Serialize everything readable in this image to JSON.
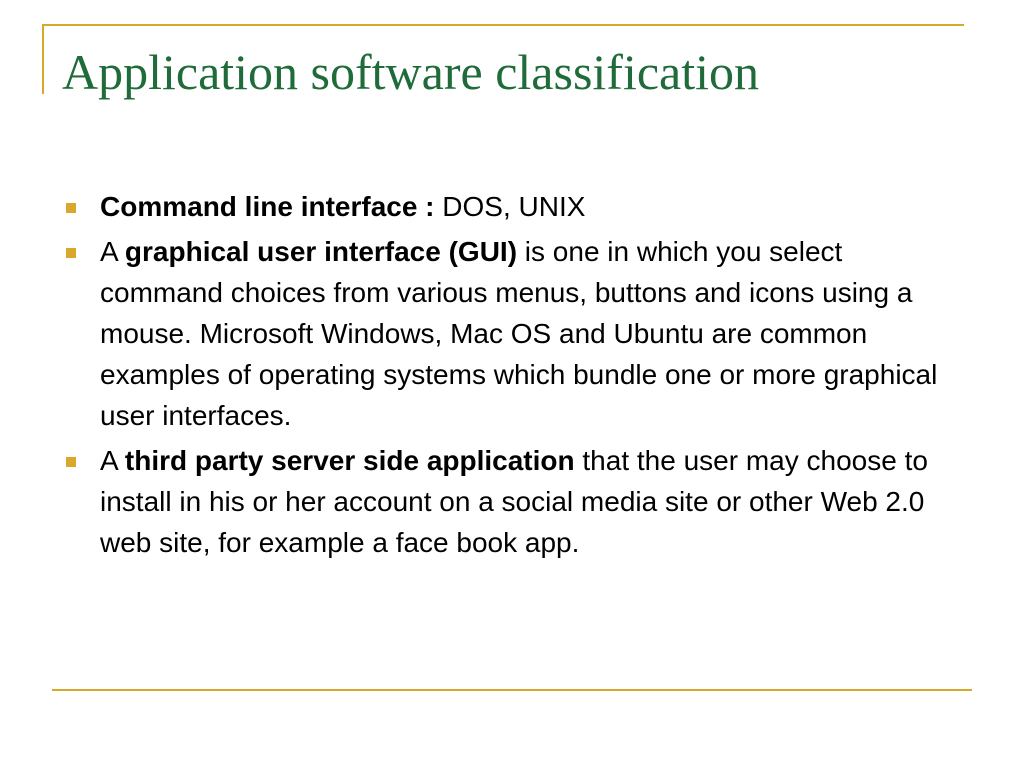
{
  "slide": {
    "title": "Application software classification",
    "bullets": [
      {
        "prefix": "",
        "bold": "Command line interface :",
        "rest": " DOS, UNIX"
      },
      {
        "prefix": "A ",
        "bold": "graphical user interface (GUI)",
        "rest": " is one in which you select command choices from various menus, buttons and icons using a mouse. Microsoft Windows, Mac OS and Ubuntu are common examples of operating systems which bundle one or more graphical user interfaces."
      },
      {
        "prefix": "A ",
        "bold": "third party server side application",
        "rest": " that the user may choose to install in his or her account on a social media site or other Web 2.0 web site, for example a face book app."
      }
    ]
  },
  "colors": {
    "title": "#1f6b3a",
    "frame": "#d9a72a",
    "bullet": "#d9a72a"
  }
}
